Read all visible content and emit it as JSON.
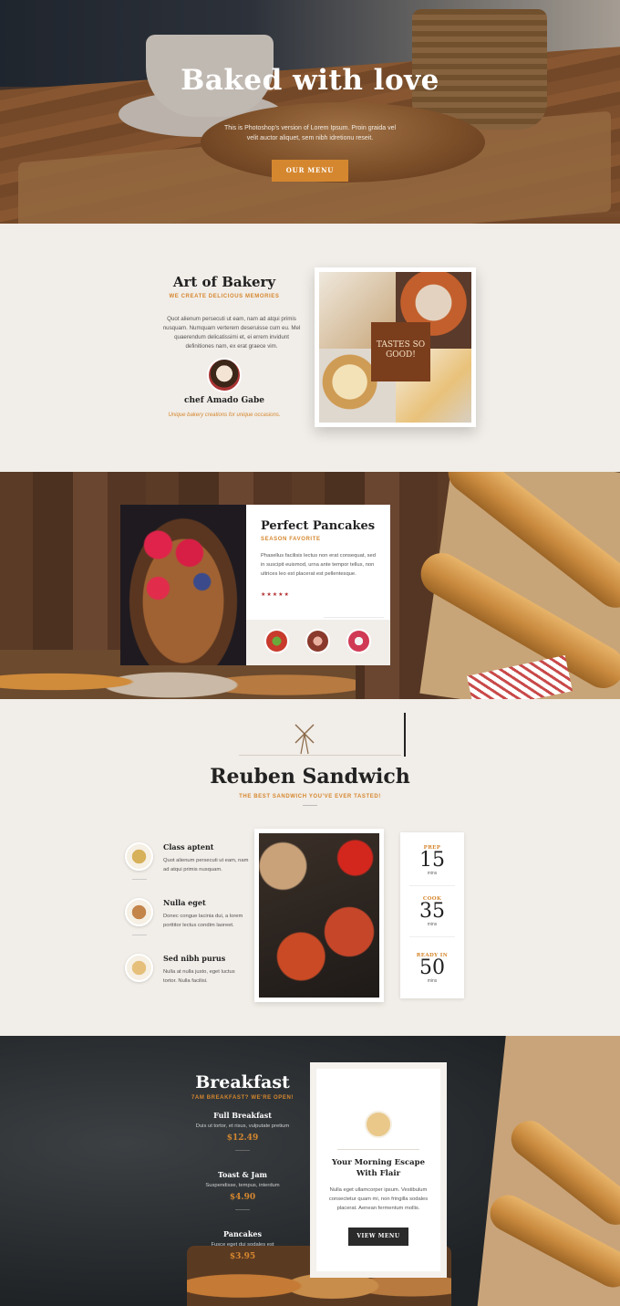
{
  "hero": {
    "title": "Baked with love",
    "text": "This is Photoshop's version of Lorem Ipsum. Proin graida vel velit auctor aliquet, sem nibh idretionu reseit.",
    "button": "OUR MENU"
  },
  "art": {
    "title": "Art of Bakery",
    "subtitle": "WE CREATE DELICIOUS MEMORIES",
    "body": "Quot alienum persecuti ut eam, nam ad atqui primis nusquam. Numquam verterem deseruisse cum eu. Mel quaerendum delicatissimi et, ei errem invidunt definitiones nam, ex erat graece vim.",
    "chef_name": "chef Amado Gabe",
    "chef_tagline": "Unique bakery creations for unique occasions.",
    "badge": "TASTES SO GOOD!"
  },
  "pancakes": {
    "title": "Perfect Pancakes",
    "subtitle": "SEASON FAVORITE",
    "body": "Phasellus facilisis lectus non erat consequat, sed in suscipit euismod, urna ante tempor tellus, non ultrices leo est placerat est pellentesque.",
    "rating": 4,
    "stars": "★★★★★"
  },
  "reuben": {
    "title": "Reuben Sandwich",
    "subtitle": "THE BEST SANDWICH YOU'VE EVER TASTED!",
    "features": [
      {
        "title": "Class aptent",
        "text": "Quot alienum persecuti ut eam, nam ad atqui primis nusquam."
      },
      {
        "title": "Nulla eget",
        "text": "Donec congue lacinia dui, a lorem porttitor lectus condim laoreet."
      },
      {
        "title": "Sed nibh purus",
        "text": "Nulla at nulla justo, eget luctus tortor. Nulla facilisi."
      }
    ],
    "times": [
      {
        "label": "PREP",
        "value": "15",
        "unit": "mins"
      },
      {
        "label": "COOK",
        "value": "35",
        "unit": "mins"
      },
      {
        "label": "READY IN",
        "value": "50",
        "unit": "mins"
      }
    ]
  },
  "breakfast": {
    "title": "Breakfast",
    "subtitle": "7AM BREAKFAST? WE'RE OPEN!",
    "items": [
      {
        "name": "Full Breakfast",
        "desc": "Duis ut tortor, et risus, vulputate pretium",
        "price": "$12.49"
      },
      {
        "name": "Toast & Jam",
        "desc": "Suspendisse, tempus, interdum",
        "price": "$4.90"
      },
      {
        "name": "Pancakes",
        "desc": "Fusce eget dui sodales est",
        "price": "$3.95"
      }
    ],
    "card": {
      "title": "Your Morning Escape With Flair",
      "body": "Nulla eget ullamcorper ipsum. Vestibulum consectetur quam mi, non fringilla sodales placerat. Aenean fermentum mollis.",
      "button": "VIEW MENU"
    }
  },
  "colors": {
    "accent": "#d5872f",
    "dark": "#2a2a2a",
    "cream": "#f1ede8"
  }
}
